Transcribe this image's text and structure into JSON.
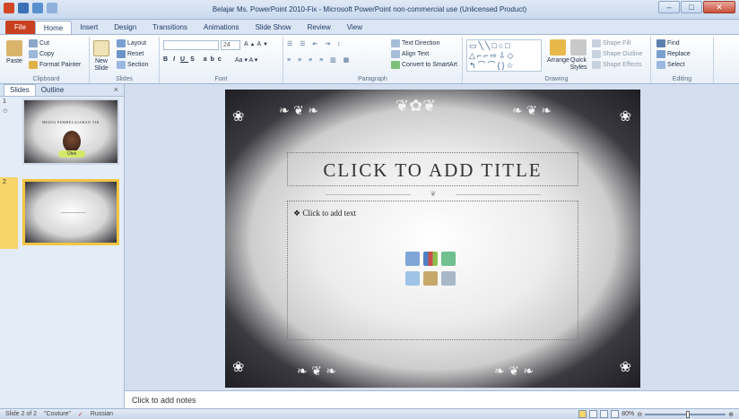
{
  "window": {
    "title": "Belajar Ms. PowerPoint 2010-Fix - Microsoft PowerPoint non-commercial use (Unlicensed Product)"
  },
  "tabs": [
    "File",
    "Home",
    "Insert",
    "Design",
    "Transitions",
    "Animations",
    "Slide Show",
    "Review",
    "View"
  ],
  "ribbon": {
    "clipboard": {
      "label": "Clipboard",
      "paste": "Paste",
      "cut": "Cut",
      "copy": "Copy",
      "format_painter": "Format Painter"
    },
    "slides": {
      "label": "Slides",
      "new_slide": "New Slide",
      "layout": "Layout",
      "reset": "Reset",
      "section": "Section"
    },
    "font": {
      "label": "Font",
      "size": "24"
    },
    "paragraph": {
      "label": "Paragraph",
      "text_direction": "Text Direction",
      "align_text": "Align Text",
      "convert": "Convert to SmartArt"
    },
    "drawing": {
      "label": "Drawing",
      "arrange": "Arrange",
      "quick_styles": "Quick Styles",
      "shape_fill": "Shape Fill",
      "shape_outline": "Shape Outline",
      "shape_effects": "Shape Effects"
    },
    "editing": {
      "label": "Editing",
      "find": "Find",
      "replace": "Replace",
      "select": "Select"
    }
  },
  "pane": {
    "tab_slides": "Slides",
    "tab_outline": "Outline",
    "close": "×",
    "thumbs": [
      {
        "num": "1",
        "title": "MEDIA PEMBELAJARAN TIK",
        "caption": "Olek"
      },
      {
        "num": "2"
      }
    ]
  },
  "slide": {
    "title_placeholder": "CLICK TO ADD TITLE",
    "body_placeholder": "Click to add text"
  },
  "notes": {
    "placeholder": "Click to add notes"
  },
  "status": {
    "slide": "Slide 2 of 2",
    "theme": "\"Couture\"",
    "language": "Russian",
    "zoom": "80%"
  }
}
